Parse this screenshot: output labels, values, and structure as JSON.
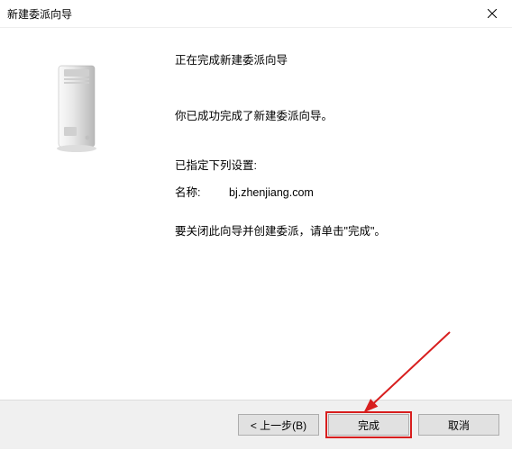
{
  "window": {
    "title": "新建委派向导"
  },
  "content": {
    "heading": "正在完成新建委派向导",
    "success_msg": "你已成功完成了新建委派向导。",
    "settings_label": "已指定下列设置:",
    "name_label": "名称:",
    "name_value": "bj.zhenjiang.com",
    "close_msg": "要关闭此向导并创建委派，请单击\"完成\"。"
  },
  "buttons": {
    "back": "< 上一步(B)",
    "finish": "完成",
    "cancel": "取消"
  },
  "icons": {
    "close": "close-icon",
    "server": "server-icon"
  },
  "annotation": {
    "arrow_color": "#d81e1e"
  }
}
